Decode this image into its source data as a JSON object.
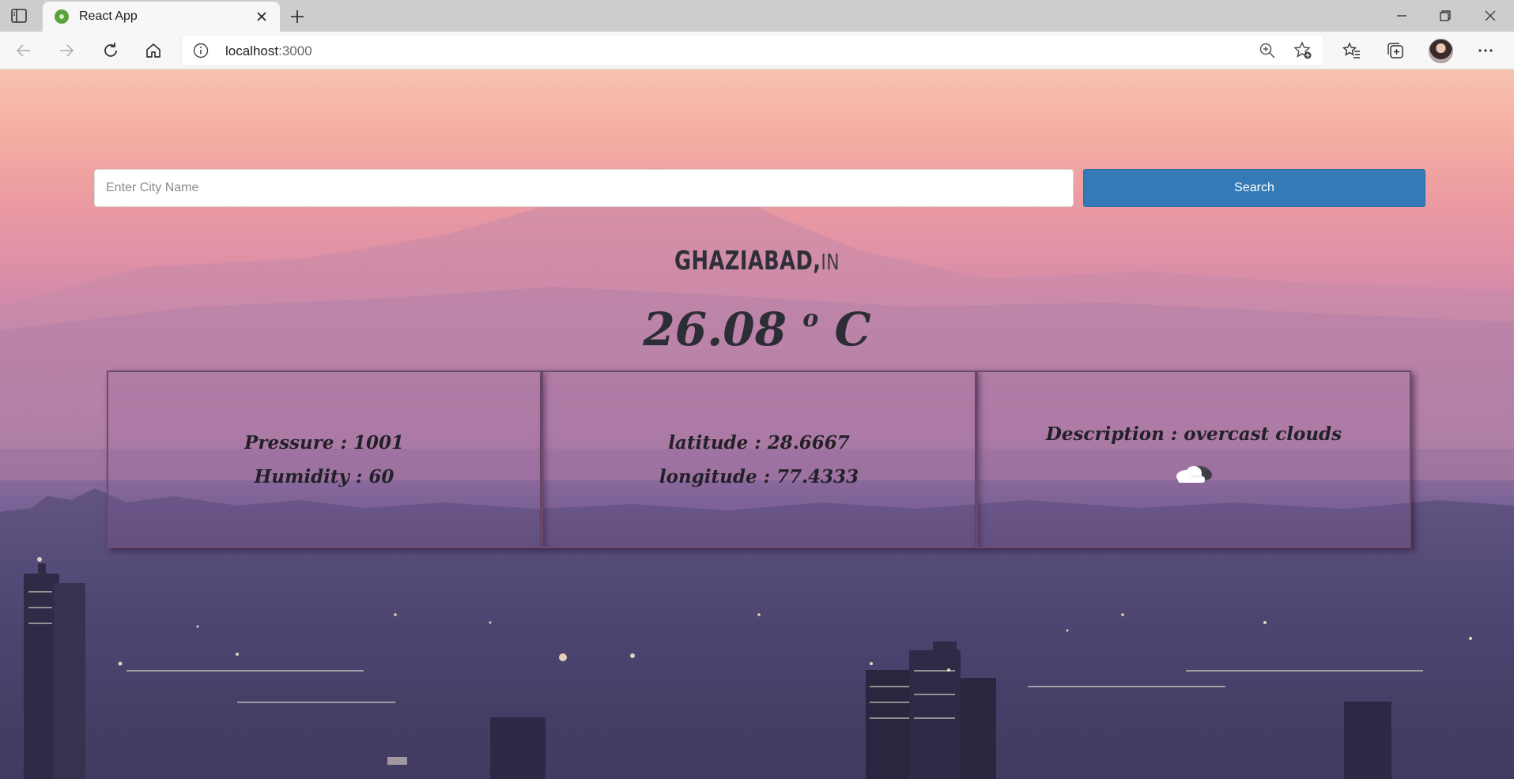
{
  "browser": {
    "tab_title": "React App",
    "url_host": "localhost",
    "url_port": ":3000",
    "icons": [
      "sidebar-toggle-icon",
      "react-favicon",
      "close-icon",
      "plus-icon",
      "minimize-icon",
      "restore-icon",
      "close-window-icon",
      "back-icon",
      "forward-icon",
      "refresh-icon",
      "home-icon",
      "info-icon",
      "zoom-icon",
      "add-favorite-icon",
      "favorites-icon",
      "collections-icon",
      "profile-avatar",
      "more-icon"
    ]
  },
  "search": {
    "placeholder": "Enter City Name",
    "value": "",
    "button_label": "Search"
  },
  "weather": {
    "city": "GHAZIABAD,",
    "country": "IN",
    "temperature": "26.08",
    "degree_symbol": "o",
    "unit": "C",
    "pressure_label": "Pressure : 1001",
    "humidity_label": "Humidity : 60",
    "latitude_label": "latitude : 28.6667",
    "longitude_label": "longitude : 77.4333",
    "description_label": "Description : overcast clouds",
    "icon": "cloud-icon"
  },
  "colors": {
    "search_button": "#337ab7",
    "text_dark": "#2d2d35"
  }
}
